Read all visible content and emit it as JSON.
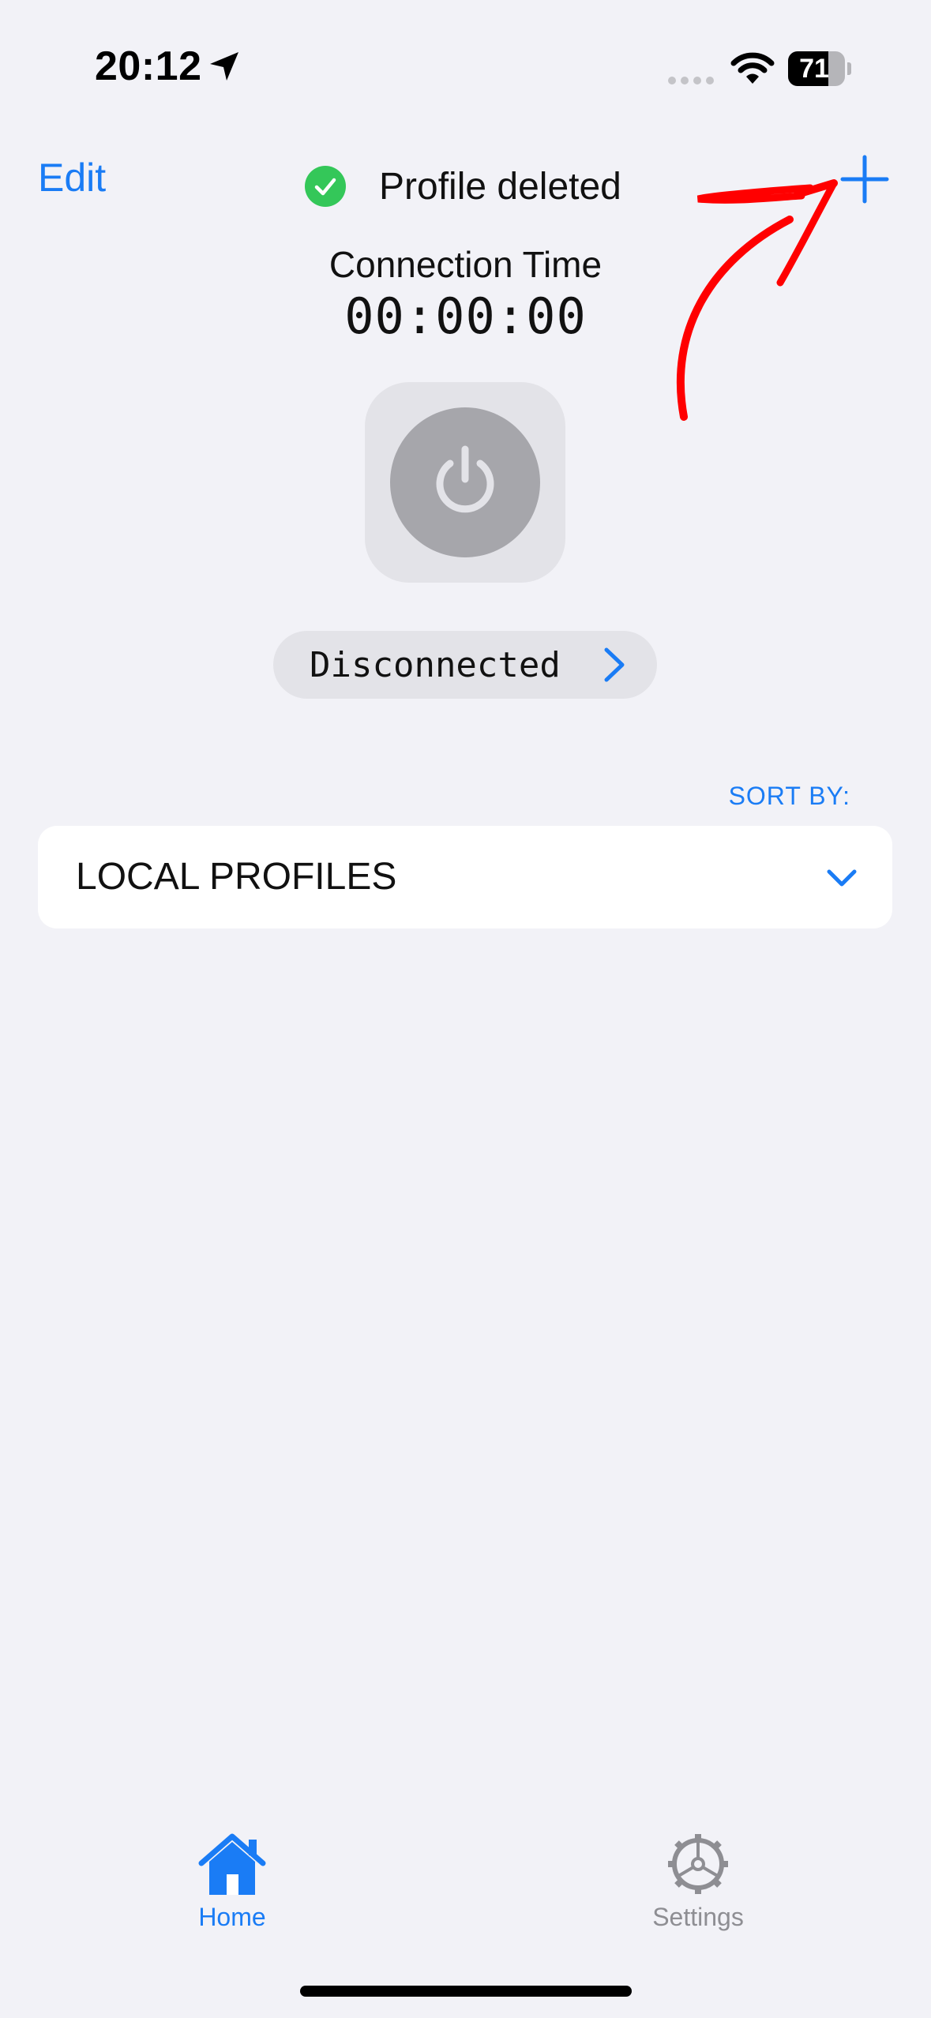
{
  "status_bar": {
    "time": "20:12",
    "battery_level": "71",
    "battery_fraction": 0.71,
    "icons": [
      "location-arrow-icon",
      "signal-icon",
      "wifi-icon",
      "battery-icon"
    ]
  },
  "nav": {
    "edit_label": "Edit",
    "toast_text": "Profile deleted",
    "toast_icon": "checkmark-circle-icon",
    "add_icon": "plus-icon"
  },
  "connection": {
    "title": "Connection Time",
    "time": "00:00:00",
    "power_icon": "power-icon",
    "status": "Disconnected"
  },
  "profiles": {
    "sort_label": "SORT BY:",
    "section_label": "LOCAL PROFILES"
  },
  "tab_bar": {
    "tabs": [
      {
        "label": "Home",
        "icon": "house-icon",
        "active": true
      },
      {
        "label": "Settings",
        "icon": "gear-icon",
        "active": false
      }
    ]
  },
  "colors": {
    "background": "#f2f2f7",
    "accent": "#1a7cf5",
    "success": "#34c759",
    "inactive": "#8e8e93",
    "annotation": "#ff0000"
  }
}
